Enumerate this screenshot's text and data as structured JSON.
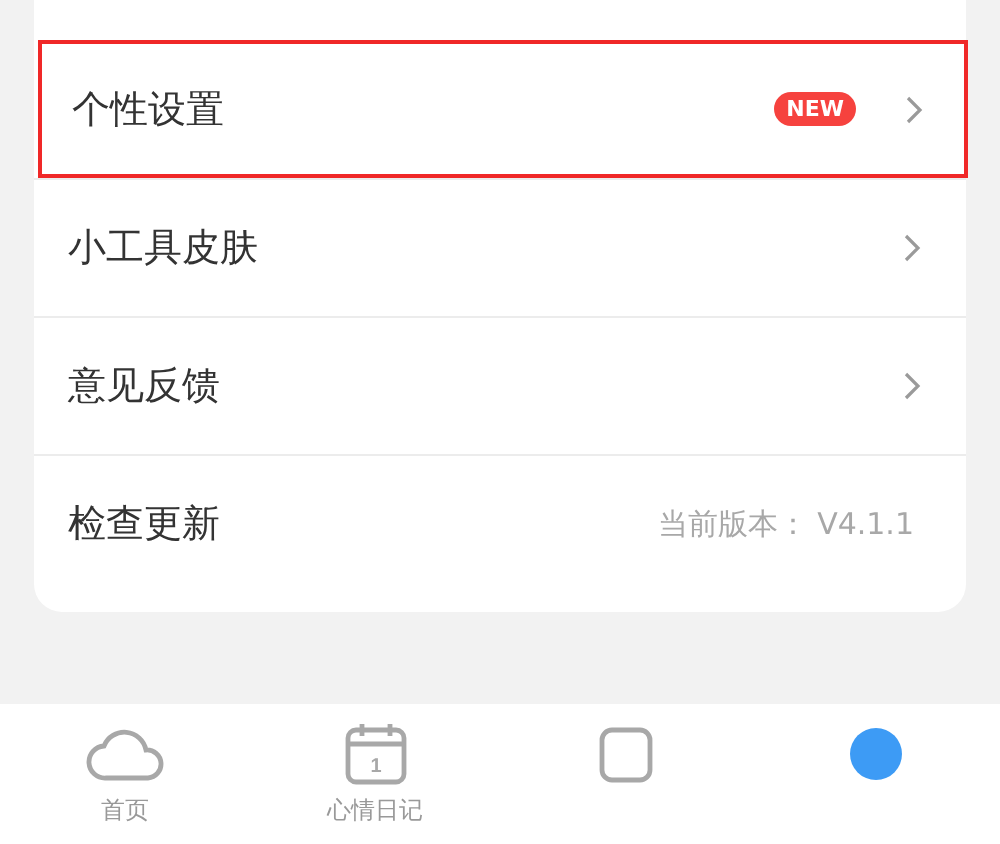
{
  "settings": [
    {
      "label": "个性设置",
      "highlighted": true,
      "badge": "NEW",
      "arrow": true
    },
    {
      "label": "小工具皮肤",
      "highlighted": false,
      "arrow": true
    },
    {
      "label": "意见反馈",
      "highlighted": false,
      "arrow": true
    },
    {
      "label": "检查更新",
      "highlighted": false,
      "arrow": false,
      "value": "当前版本： V4.1.1"
    }
  ],
  "tab_bar": [
    {
      "kind": "cloud",
      "label": "首页"
    },
    {
      "kind": "calendar",
      "label": "心情日记",
      "icon_text": "1"
    },
    {
      "kind": "box"
    },
    {
      "kind": "circle"
    }
  ]
}
